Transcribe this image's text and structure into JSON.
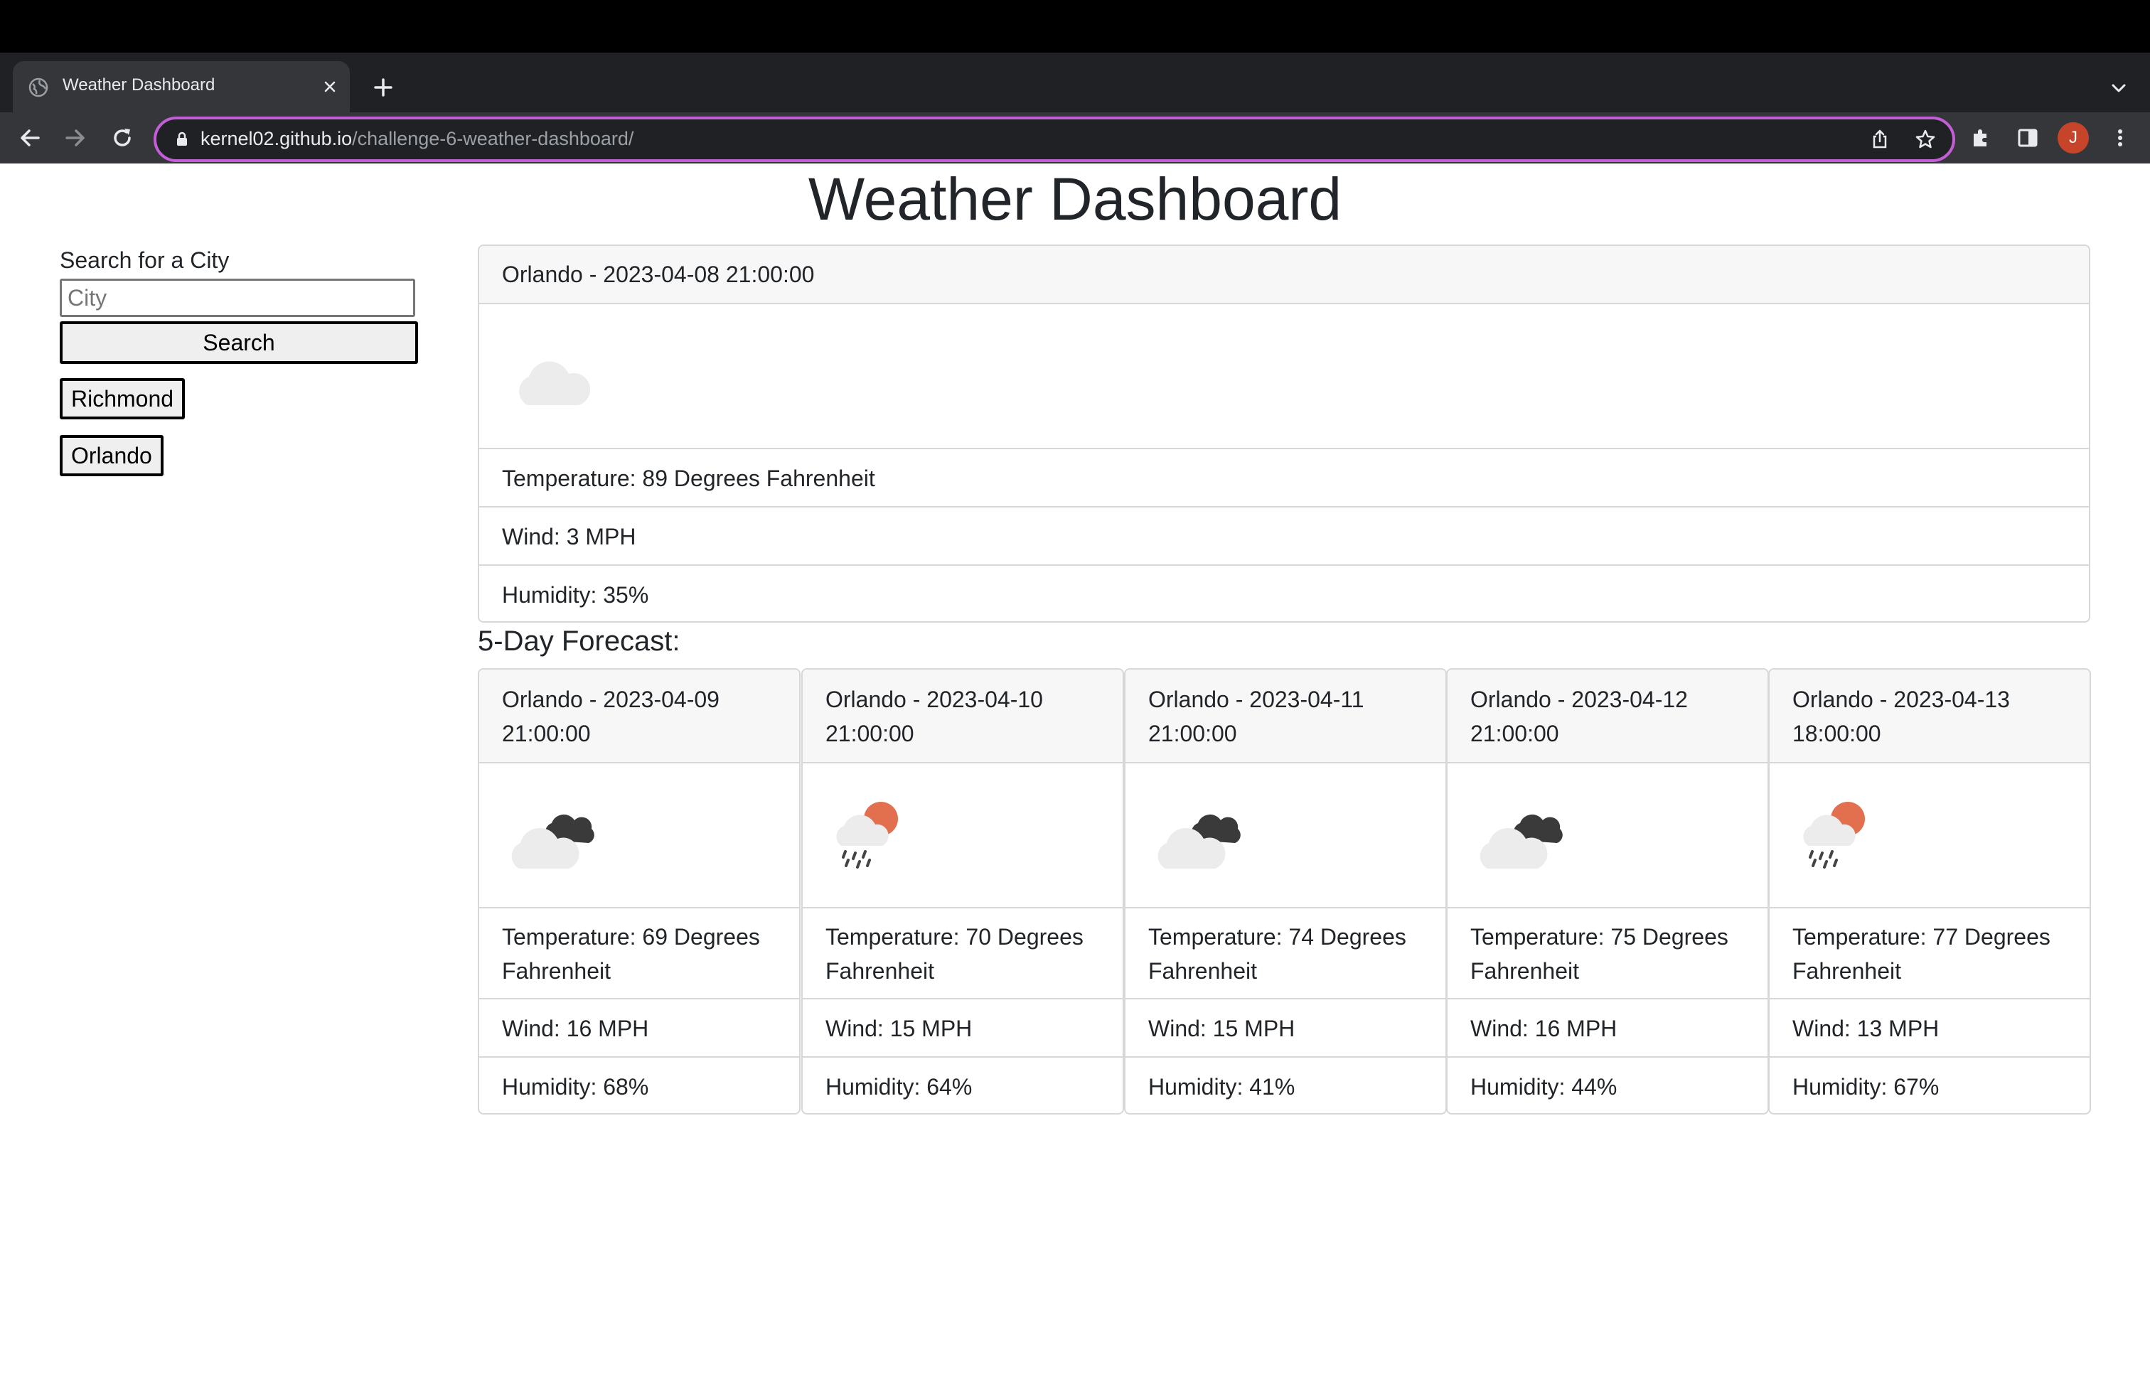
{
  "browser": {
    "tab_title": "Weather Dashboard",
    "url_host": "kernel02.github.io",
    "url_path": "/challenge-6-weather-dashboard/",
    "avatar_letter": "J",
    "accent_color": "#c35fd6"
  },
  "page": {
    "title": "Weather Dashboard"
  },
  "search": {
    "label": "Search for a City",
    "placeholder": "City",
    "button_label": "Search",
    "history": [
      "Richmond",
      "Orlando"
    ]
  },
  "current": {
    "header": "Orlando - 2023-04-08 21:00:00",
    "icon": "cloud-icon",
    "temperature": "Temperature: 89 Degrees Fahrenheit",
    "wind": "Wind: 3 MPH",
    "humidity": "Humidity: 35%"
  },
  "forecast": {
    "title": "5-Day Forecast:",
    "days": [
      {
        "header": "Orlando - 2023-04-09 21:00:00",
        "icon": "broken-clouds-icon",
        "temperature": "Temperature: 69 Degrees Fahrenheit",
        "wind": "Wind: 16 MPH",
        "humidity": "Humidity: 68%"
      },
      {
        "header": "Orlando - 2023-04-10 21:00:00",
        "icon": "rain-sun-icon",
        "temperature": "Temperature: 70 Degrees Fahrenheit",
        "wind": "Wind: 15 MPH",
        "humidity": "Humidity: 64%"
      },
      {
        "header": "Orlando - 2023-04-11 21:00:00",
        "icon": "broken-clouds-icon",
        "temperature": "Temperature: 74 Degrees Fahrenheit",
        "wind": "Wind: 15 MPH",
        "humidity": "Humidity: 41%"
      },
      {
        "header": "Orlando - 2023-04-12 21:00:00",
        "icon": "broken-clouds-icon",
        "temperature": "Temperature: 75 Degrees Fahrenheit",
        "wind": "Wind: 16 MPH",
        "humidity": "Humidity: 44%"
      },
      {
        "header": "Orlando - 2023-04-13 18:00:00",
        "icon": "rain-sun-icon",
        "temperature": "Temperature: 77 Degrees Fahrenheit",
        "wind": "Wind: 13 MPH",
        "humidity": "Humidity: 67%"
      }
    ]
  }
}
